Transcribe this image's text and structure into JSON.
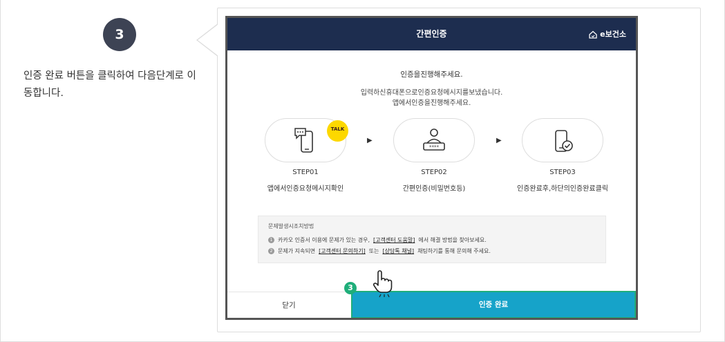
{
  "guide": {
    "step_number": "3",
    "description": "인증 완료 버튼을 클릭하여 다음단계로 이동합니다."
  },
  "modal": {
    "title": "간편인증",
    "brand": "e보건소",
    "notice_main": "인증을진행해주세요.",
    "notice_line1": "입력하신휴대폰으로인증요청메시지를보냈습니다.",
    "notice_line2": "앱에서인증을진행해주세요.",
    "kakao_badge": "TALK",
    "steps": [
      {
        "label": "STEP01",
        "desc": "앱에서인증요청메시지확인",
        "icon": "phone-chat-icon"
      },
      {
        "label": "STEP02",
        "desc": "간편인증(비밀번호등)",
        "icon": "user-password-icon"
      },
      {
        "label": "STEP03",
        "desc": "인증완료후,하단의인증완료클릭",
        "icon": "phone-check-icon"
      }
    ],
    "arrow_glyph": "▶",
    "help": {
      "title": "문제발생시조치방법",
      "item1_num": "1",
      "item1_pre": "카카오 인증서 이용에 문제가 있는 경우,",
      "item1_link": "[고객센터 도움말]",
      "item1_post": "에서 해결 방법을 찾아보세요.",
      "item2_num": "2",
      "item2_pre": "문제가 지속되면",
      "item2_link1": "[고객센터 문의하기]",
      "item2_mid": "또는",
      "item2_link2": "[상담톡 채널]",
      "item2_post": "채팅하기를 통해 문의해 주세요."
    },
    "close_label": "닫기",
    "complete_label": "인증 완료",
    "callout_number": "3"
  },
  "colors": {
    "header_bg": "#1d2d4f",
    "complete_bg": "#16a3c9",
    "callout_green": "#1fae7a",
    "kakao_yellow": "#fdd800",
    "badge_bg": "#3d4354"
  }
}
